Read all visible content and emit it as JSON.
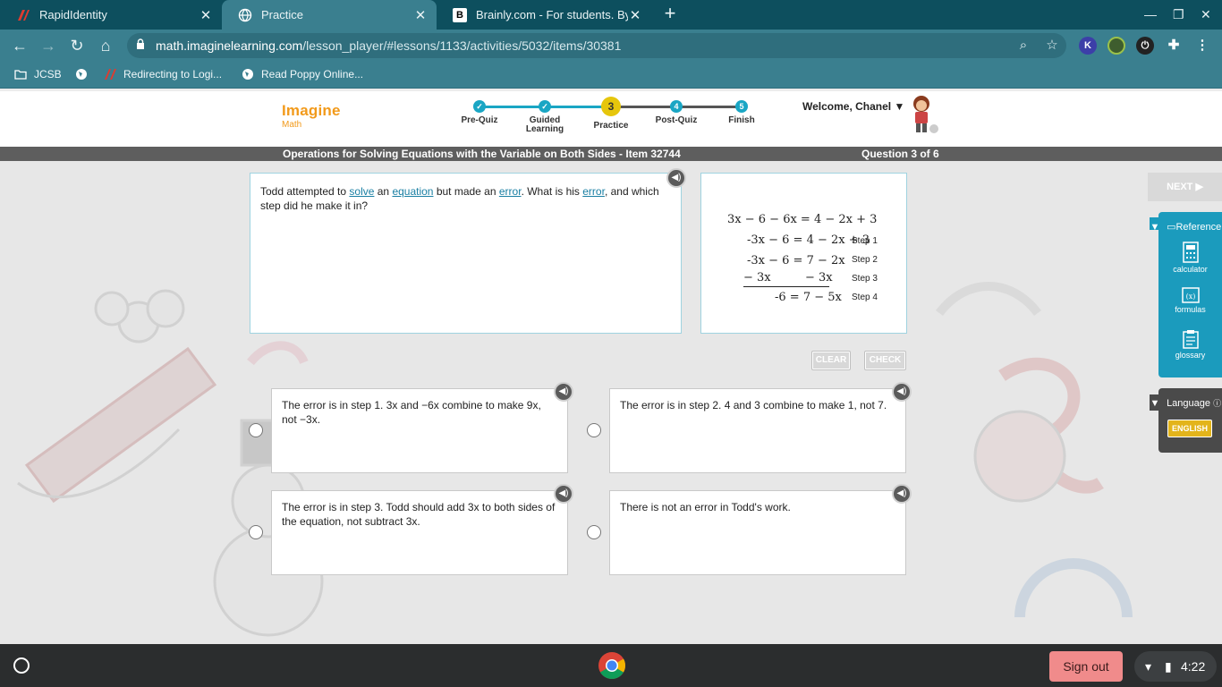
{
  "browser": {
    "tabs": [
      {
        "title": "RapidIdentity",
        "favicon": "rapididentity-icon"
      },
      {
        "title": "Practice",
        "favicon": "globe-icon"
      },
      {
        "title": "Brainly.com - For students. By st",
        "favicon": "brainly-icon"
      }
    ],
    "url_host": "math.imaginelearning.com",
    "url_path": "/lesson_player/#lessons/1133/activities/5032/items/30381",
    "bookmarks": [
      "JCSB",
      "Redirecting to Logi...",
      "Read Poppy Online..."
    ],
    "extension_letter": "K"
  },
  "header": {
    "logo_main": "Imagine",
    "logo_sub": "Math",
    "steps": [
      {
        "label": "Pre-Quiz",
        "state": "done"
      },
      {
        "label": "Guided Learning",
        "state": "done"
      },
      {
        "label": "Practice",
        "state": "current",
        "number": "3"
      },
      {
        "label": "Post-Quiz",
        "state": "upcoming",
        "number": "4"
      },
      {
        "label": "Finish",
        "state": "upcoming",
        "number": "5"
      }
    ],
    "welcome": "Welcome, Chanel"
  },
  "lesson": {
    "title": "Operations for Solving Equations with the Variable on Both Sides - Item 32744",
    "question_counter": "Question 3 of 6"
  },
  "prompt": {
    "t1": "Todd attempted to ",
    "link1": "solve",
    "t2": " an ",
    "link2": "equation",
    "t3": " but made an ",
    "link3": "error",
    "t4": ". What is his ",
    "link4": "error",
    "t5": ", and which step did he make it in?"
  },
  "work": {
    "line0": "3x − 6 − 6x = 4 − 2x + 3",
    "line1": "-3x − 6 = 4 − 2x + 3",
    "line2": "-3x − 6 = 7 − 2x",
    "line3a": "− 3x",
    "line3b": "− 3x",
    "line4": "-6 = 7 − 5x",
    "step1": "Step 1",
    "step2": "Step 2",
    "step3": "Step 3",
    "step4": "Step 4"
  },
  "controls": {
    "clear": "CLEAR",
    "check": "CHECK",
    "next": "NEXT ▶"
  },
  "choices": [
    {
      "text": "The error is in step 1. 3x and −6x combine to make 9x, not −3x."
    },
    {
      "text": "The error is in step 2. 4 and 3 combine to make 1, not 7."
    },
    {
      "text": "The error is in step 3. Todd should add 3x to both sides of the equation, not subtract 3x."
    },
    {
      "text": "There is not an error in Todd's work."
    }
  ],
  "sidebar": {
    "reference_title": "Reference",
    "tools": [
      "calculator",
      "formulas",
      "glossary"
    ],
    "language_title": "Language",
    "language_value": "ENGLISH"
  },
  "shelf": {
    "signout": "Sign out",
    "time": "4:22"
  },
  "colors": {
    "tab_bar": "#0d4f5e",
    "toolbar": "#3a7f8f",
    "accent_teal": "#1aa6c4",
    "current_step": "#e6c60c",
    "logo_orange": "#f29a1b",
    "signout": "#f08b8b"
  }
}
